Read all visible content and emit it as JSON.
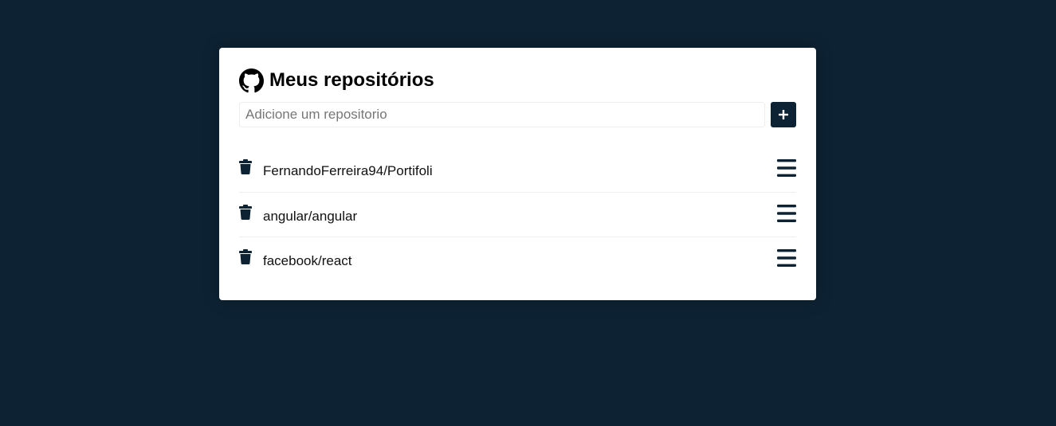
{
  "header": {
    "icon": "github-icon",
    "title": "Meus repositórios"
  },
  "add_form": {
    "input_value": "",
    "input_placeholder": "Adicione um repositorio",
    "button_icon": "plus-icon"
  },
  "repositories": [
    {
      "name": "FernandoFerreira94/Portifoli",
      "delete_icon": "trash-icon",
      "details_icon": "bars-icon"
    },
    {
      "name": "angular/angular",
      "delete_icon": "trash-icon",
      "details_icon": "bars-icon"
    },
    {
      "name": "facebook/react",
      "delete_icon": "trash-icon",
      "details_icon": "bars-icon"
    }
  ],
  "colors": {
    "background": "#0d2233",
    "card": "#ffffff",
    "accent": "#0d2233"
  }
}
